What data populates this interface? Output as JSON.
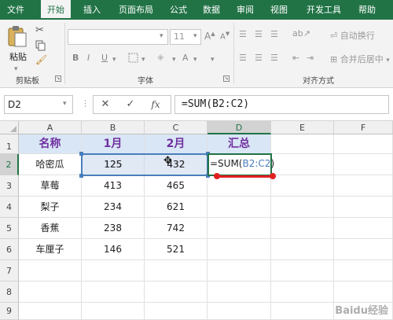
{
  "ribbon_tabs": [
    {
      "label": "文件",
      "active": false
    },
    {
      "label": "开始",
      "active": true
    },
    {
      "label": "插入",
      "active": false
    },
    {
      "label": "页面布局",
      "active": false
    },
    {
      "label": "公式",
      "active": false
    },
    {
      "label": "数据",
      "active": false
    },
    {
      "label": "审阅",
      "active": false
    },
    {
      "label": "视图",
      "active": false
    },
    {
      "label": "开发工具",
      "active": false
    },
    {
      "label": "帮助",
      "active": false
    }
  ],
  "ribbon": {
    "clipboard": {
      "paste_label": "粘贴",
      "group_label": "剪贴板"
    },
    "font": {
      "size": "11",
      "grow_label": "A",
      "shrink_label": "A",
      "bold": "B",
      "italic": "I",
      "underline": "U",
      "font_color_label": "A",
      "group_label": "字体"
    },
    "alignment": {
      "wrap_label": "自动换行",
      "merge_label": "合并后居中",
      "group_label": "对齐方式"
    }
  },
  "formula_bar": {
    "name_box": "D2",
    "cancel_glyph": "✕",
    "enter_glyph": "✓",
    "fx_glyph": "fx",
    "formula": "=SUM(B2:C2)"
  },
  "sheet": {
    "columns": [
      "A",
      "B",
      "C",
      "D",
      "E",
      "F"
    ],
    "rows": [
      "1",
      "2",
      "3",
      "4",
      "5",
      "6",
      "7",
      "8",
      "9"
    ],
    "header_row": [
      "名称",
      "1月",
      "2月",
      "汇总"
    ],
    "data": [
      [
        "哈密瓜",
        "125",
        "432"
      ],
      [
        "草莓",
        "413",
        "465"
      ],
      [
        "梨子",
        "234",
        "621"
      ],
      [
        "香蕉",
        "238",
        "742"
      ],
      [
        "车厘子",
        "146",
        "521"
      ]
    ],
    "active_cell_text_prefix": "=SUM(",
    "active_cell_ref": "B2:C2",
    "active_cell_text_suffix": ")"
  },
  "colors": {
    "excel_green": "#217346",
    "header_fill": "#d9e6f5",
    "header_text": "#7030a0",
    "ref_blue": "#4a7ebb",
    "annotation_red": "#e02020"
  },
  "watermark": "Baidu经验"
}
